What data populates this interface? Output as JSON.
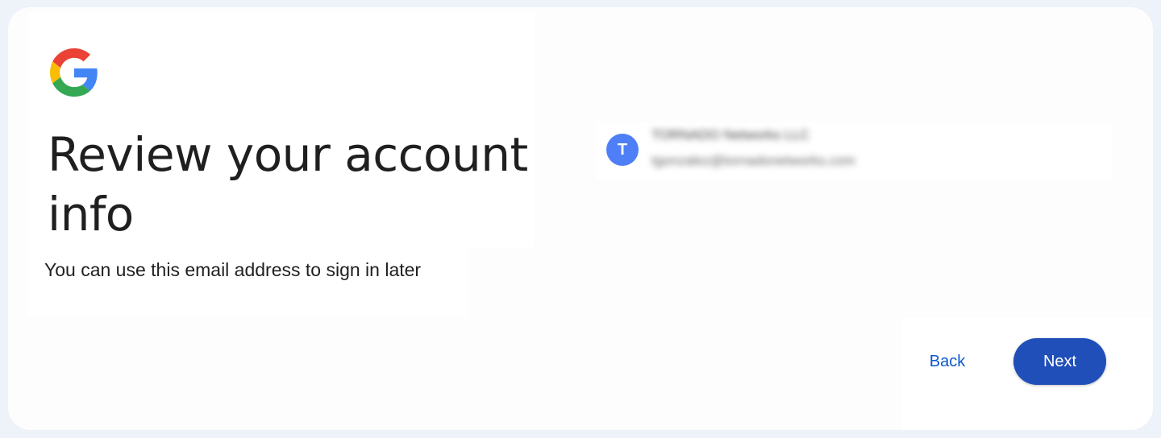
{
  "page": {
    "title": "Review your account info",
    "subtitle": "You can use this email address to sign in later"
  },
  "logo": {
    "icon": "google-g-logo",
    "colors": {
      "red": "#ea4335",
      "yellow": "#fbbc05",
      "green": "#34a853",
      "blue": "#4285f4"
    }
  },
  "account": {
    "avatar_initial": "T",
    "avatar_color": "#4e7ff6",
    "name_obscured": "TORNADO Networks LLC",
    "email_obscured": "tgonzalez@tornadonetworks.com"
  },
  "actions": {
    "back_label": "Back",
    "next_label": "Next",
    "accent": "#214fb9"
  }
}
